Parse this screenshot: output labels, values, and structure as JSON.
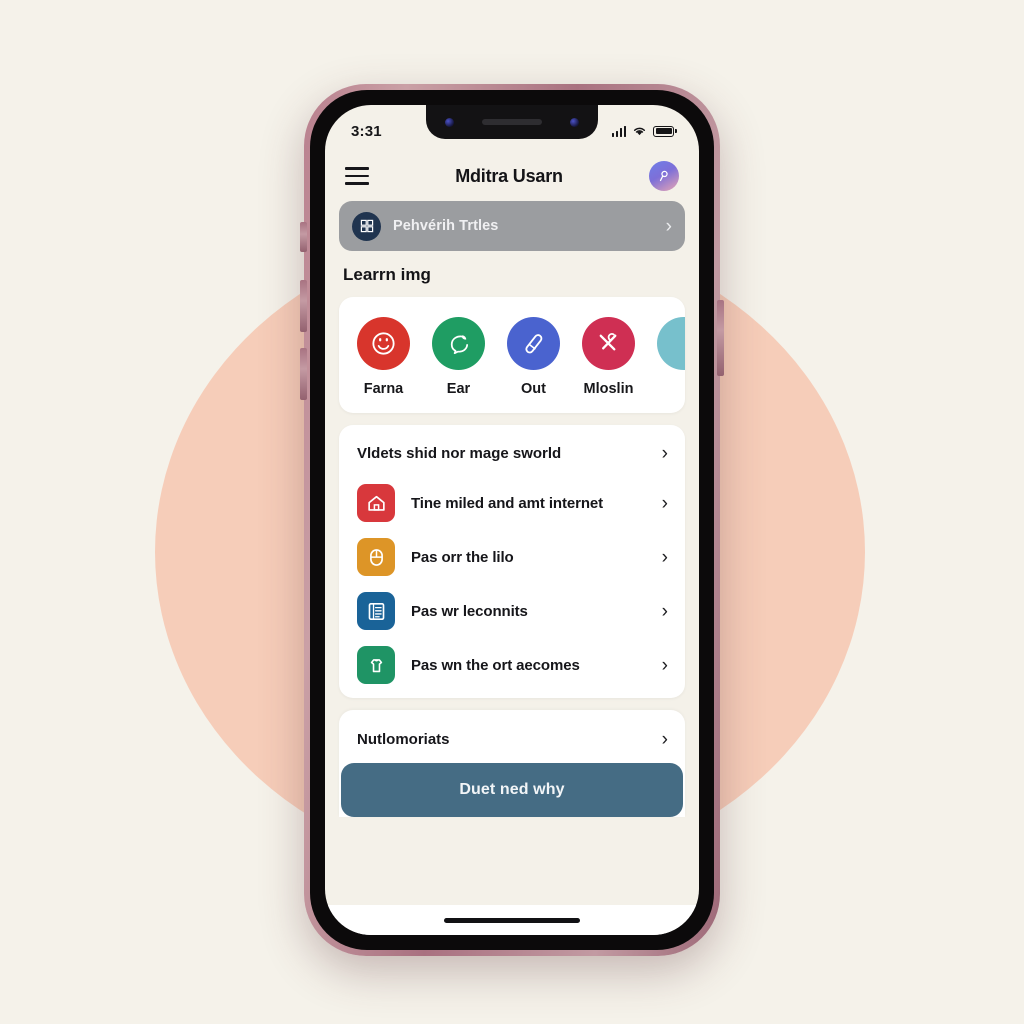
{
  "status_bar": {
    "time": "3:31",
    "icons": [
      "signal-bars-icon",
      "wifi-icon",
      "battery-icon"
    ]
  },
  "header": {
    "menu_icon": "hamburger-menu-icon",
    "title": "Mditra Usarn",
    "avatar_icon": "user-avatar-icon"
  },
  "banner": {
    "icon": "grid-badge-icon",
    "label": "Pehvérih Trtles",
    "chevron": "›",
    "bg_color": "#9b9da0"
  },
  "section_title": "Learrn img",
  "categories": [
    {
      "label": "Farna",
      "color": "#d8352c",
      "icon": "face-circle-icon"
    },
    {
      "label": "Ear",
      "color": "#1f9d63",
      "icon": "leaf-speech-icon"
    },
    {
      "label": "Out",
      "color": "#4a63cf",
      "icon": "pen-diagonal-icon"
    },
    {
      "label": "Mloslin",
      "color": "#cf2f53",
      "icon": "tools-cross-icon"
    },
    {
      "label": "",
      "color": "#77c0cc",
      "icon": "partial-circle-icon"
    }
  ],
  "list_card": {
    "header": "Vldets shid nor mage sworld",
    "chevron": "›",
    "rows": [
      {
        "label": "Tine miled and amt internet",
        "color": "#d8383c",
        "icon": "house-icon"
      },
      {
        "label": "Pas orr the lilo",
        "color": "#dd9527",
        "icon": "mouse-icon"
      },
      {
        "label": "Pas wr leconnits",
        "color": "#1a6398",
        "icon": "list-document-icon"
      },
      {
        "label": "Pas wn the ort aecomes",
        "color": "#1f9465",
        "icon": "shirt-tap-icon"
      }
    ]
  },
  "footer": {
    "row_label": "Nutlomoriats",
    "chevron": "›",
    "cta_label": "Duet ned why",
    "cta_color": "#456c84"
  },
  "home_indicator": "home-indicator-bar"
}
